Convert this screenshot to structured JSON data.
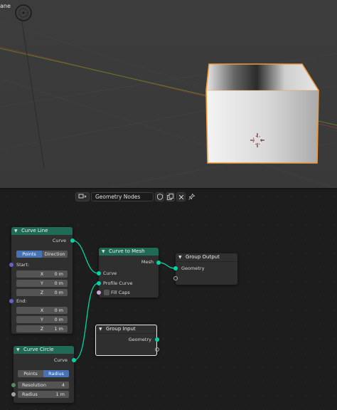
{
  "viewport": {
    "partial_label": "ane"
  },
  "editor_header": {
    "tree_name": "Geometry Nodes",
    "icons": [
      "editor-type-icon",
      "fake-user-shield-icon",
      "copy-icon",
      "close-icon",
      "pin-icon"
    ]
  },
  "nodes": {
    "curve_line": {
      "title": "Curve Line",
      "output_curve": "Curve",
      "mode_points": "Points",
      "mode_direction": "Direction",
      "start_label": "Start:",
      "start": [
        {
          "axis": "X",
          "value": "0 m"
        },
        {
          "axis": "Y",
          "value": "0 m"
        },
        {
          "axis": "Z",
          "value": "0 m"
        }
      ],
      "end_label": "End:",
      "end": [
        {
          "axis": "X",
          "value": "0 m"
        },
        {
          "axis": "Y",
          "value": "0 m"
        },
        {
          "axis": "Z",
          "value": "1 m"
        }
      ]
    },
    "curve_circle": {
      "title": "Curve Circle",
      "output_curve": "Curve",
      "mode_points": "Points",
      "mode_radius": "Radius",
      "resolution_label": "Resolution",
      "resolution_value": "4",
      "radius_label": "Radius",
      "radius_value": "1 m"
    },
    "curve_to_mesh": {
      "title": "Curve to Mesh",
      "output_mesh": "Mesh",
      "input_curve": "Curve",
      "input_profile": "Profile Curve",
      "fill_caps": "Fill Caps"
    },
    "group_output": {
      "title": "Group Output",
      "input_geometry": "Geometry"
    },
    "group_input": {
      "title": "Group Input",
      "output_geometry": "Geometry"
    }
  },
  "colors": {
    "geometry_node_header": "#1f6b55",
    "group_node_header": "#303030",
    "curve_socket": "#00d6a3",
    "vector_socket": "#6363c7",
    "float_socket": "#a1a1a1",
    "bool_socket": "#cca6d6",
    "selection_outline": "#f29b38",
    "enum_active": "#4772b3"
  }
}
